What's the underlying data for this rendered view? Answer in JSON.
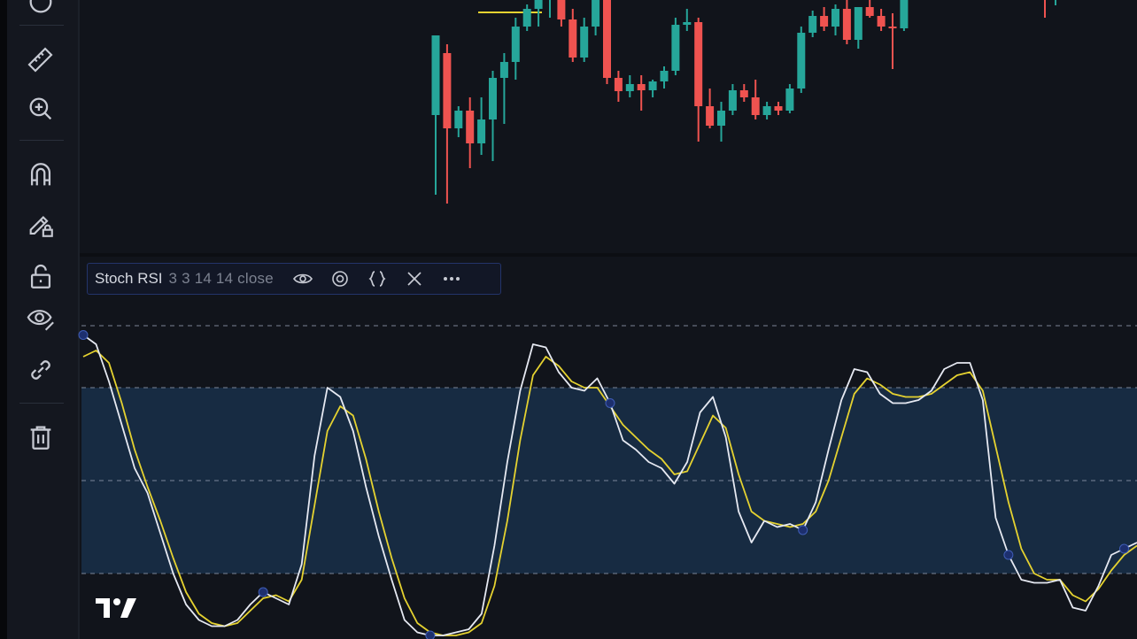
{
  "indicator": {
    "name": "Stoch RSI",
    "params": "3 3 14 14 close"
  },
  "colors": {
    "toolbar_bg": "#14171f",
    "chart_bg": "#11141b",
    "up_candle": "#26a69a",
    "down_candle": "#ef5350",
    "k_line": "#e6e9f2",
    "d_line": "#e5d230",
    "band_fill": "#1a3350",
    "icon": "#c7cad3",
    "crosshair_marker": "#1d2f6e"
  },
  "toolbar": {
    "icons": [
      "measure-icon",
      "zoom-in-icon",
      "magnet-icon",
      "lock-drawing-icon",
      "unlock-icon",
      "eye-icon",
      "link-icon",
      "trash-icon"
    ]
  },
  "legend_buttons": [
    "eye-icon",
    "settings-icon",
    "source-code-icon",
    "close-icon",
    "more-icon"
  ],
  "logo": "tradingview-logo",
  "chart_data": {
    "type": "line",
    "ylim": [
      0,
      100
    ],
    "bands": [
      20,
      50,
      80,
      100
    ],
    "series": [
      {
        "values": [
          97,
          94,
          82,
          68,
          54,
          46,
          33,
          20,
          10,
          5,
          3,
          3,
          5,
          10,
          14,
          12,
          10,
          23,
          58,
          80,
          77,
          66,
          48,
          32,
          18,
          5,
          1,
          0,
          0,
          1,
          2,
          7,
          29,
          56,
          79,
          94,
          93,
          85,
          80,
          79,
          83,
          75,
          63,
          60,
          56,
          54,
          49,
          56,
          72,
          77,
          64,
          40,
          30,
          37,
          35,
          36,
          34,
          43,
          60,
          76,
          86,
          85,
          78,
          75,
          75,
          76,
          79,
          86,
          88,
          88,
          76,
          38,
          26,
          18,
          17,
          17,
          18,
          9,
          8,
          16,
          26,
          28,
          30
        ],
        "color_key": "k_line"
      },
      {
        "values": [
          90,
          92,
          88,
          75,
          60,
          48,
          37,
          25,
          14,
          7,
          4,
          3,
          4,
          8,
          12,
          13,
          11,
          18,
          42,
          66,
          74,
          71,
          57,
          40,
          25,
          12,
          4,
          1,
          0,
          0,
          1,
          4,
          16,
          37,
          63,
          84,
          90,
          87,
          82,
          80,
          80,
          74,
          68,
          64,
          60,
          57,
          52,
          53,
          62,
          71,
          67,
          52,
          40,
          37,
          36,
          35,
          36,
          40,
          50,
          64,
          78,
          83,
          81,
          78,
          77,
          77,
          78,
          81,
          84,
          85,
          79,
          61,
          43,
          28,
          20,
          18,
          18,
          13,
          11,
          15,
          21,
          26,
          29
        ],
        "color_key": "d_line"
      }
    ],
    "candles": [
      {
        "o": 130,
        "h": 110,
        "l": 220,
        "c": 40
      },
      {
        "o": 60,
        "h": 50,
        "l": 230,
        "c": 145
      },
      {
        "o": 145,
        "h": 120,
        "l": 155,
        "c": 125
      },
      {
        "o": 125,
        "h": 110,
        "l": 190,
        "c": 162
      },
      {
        "o": 162,
        "h": 110,
        "l": 175,
        "c": 135
      },
      {
        "o": 135,
        "h": 80,
        "l": 182,
        "c": 88
      },
      {
        "o": 88,
        "h": 60,
        "l": 140,
        "c": 70
      },
      {
        "o": 70,
        "h": 20,
        "l": 90,
        "c": 30
      },
      {
        "o": 30,
        "h": 5,
        "l": 35,
        "c": 10
      },
      {
        "o": 10,
        "h": -10,
        "l": 30,
        "c": 0
      },
      {
        "o": 0,
        "h": -20,
        "l": 20,
        "c": -5
      },
      {
        "o": -5,
        "h": -20,
        "l": 30,
        "c": 22
      },
      {
        "o": 22,
        "h": 10,
        "l": 70,
        "c": 65
      },
      {
        "o": 65,
        "h": 20,
        "l": 70,
        "c": 30
      },
      {
        "o": 30,
        "h": -10,
        "l": 40,
        "c": -5
      },
      {
        "o": -5,
        "h": -20,
        "l": 95,
        "c": 88
      },
      {
        "o": 88,
        "h": 80,
        "l": 115,
        "c": 103
      },
      {
        "o": 103,
        "h": 85,
        "l": 110,
        "c": 95
      },
      {
        "o": 95,
        "h": 85,
        "l": 125,
        "c": 102
      },
      {
        "o": 102,
        "h": 90,
        "l": 110,
        "c": 92
      },
      {
        "o": 92,
        "h": 75,
        "l": 100,
        "c": 80
      },
      {
        "o": 80,
        "h": 20,
        "l": 85,
        "c": 28
      },
      {
        "o": 28,
        "h": 10,
        "l": 35,
        "c": 25
      },
      {
        "o": 25,
        "h": 20,
        "l": 160,
        "c": 120
      },
      {
        "o": 120,
        "h": 100,
        "l": 145,
        "c": 142
      },
      {
        "o": 142,
        "h": 115,
        "l": 160,
        "c": 125
      },
      {
        "o": 125,
        "h": 95,
        "l": 130,
        "c": 102
      },
      {
        "o": 102,
        "h": 95,
        "l": 115,
        "c": 110
      },
      {
        "o": 110,
        "h": 90,
        "l": 135,
        "c": 130
      },
      {
        "o": 130,
        "h": 115,
        "l": 135,
        "c": 120
      },
      {
        "o": 120,
        "h": 115,
        "l": 130,
        "c": 125
      },
      {
        "o": 125,
        "h": 95,
        "l": 128,
        "c": 100
      },
      {
        "o": 100,
        "h": 30,
        "l": 105,
        "c": 37
      },
      {
        "o": 37,
        "h": 12,
        "l": 42,
        "c": 18
      },
      {
        "o": 18,
        "h": 8,
        "l": 35,
        "c": 30
      },
      {
        "o": 30,
        "h": 5,
        "l": 40,
        "c": 10
      },
      {
        "o": 10,
        "h": 0,
        "l": 50,
        "c": 45
      },
      {
        "o": 45,
        "h": 10,
        "l": 55,
        "c": 8
      },
      {
        "o": 8,
        "h": 0,
        "l": 20,
        "c": 18
      },
      {
        "o": 18,
        "h": 10,
        "l": 35,
        "c": 30
      },
      {
        "o": 30,
        "h": 15,
        "l": 78,
        "c": 32
      },
      {
        "o": 32,
        "h": 0,
        "l": 35,
        "c": 0
      }
    ]
  }
}
